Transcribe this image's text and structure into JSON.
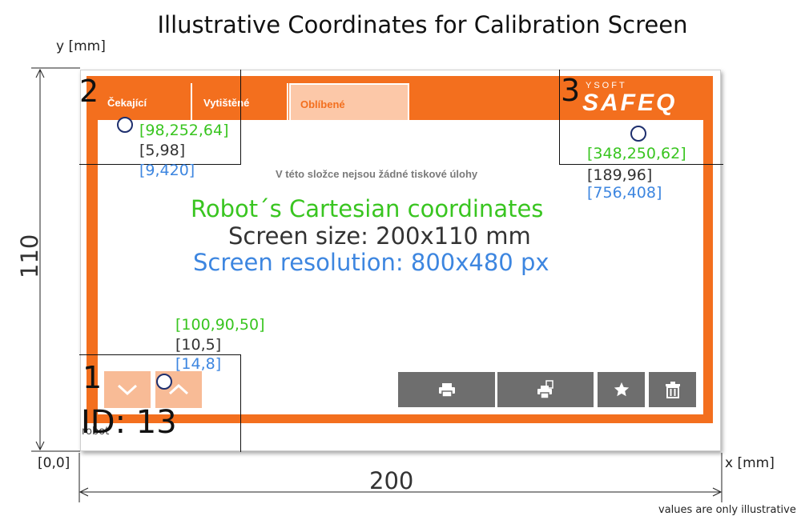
{
  "title": "Illustrative Coordinates for Calibration Screen",
  "axes": {
    "y_label": "y [mm]",
    "x_label": "x [mm]",
    "origin": "[0,0]",
    "height_dim": "110",
    "width_dim": "200"
  },
  "note": "values are only illustrative",
  "screen": {
    "tabs": [
      {
        "label": "Čekající",
        "active": false
      },
      {
        "label": "Vytištěné",
        "active": false
      },
      {
        "label": "Oblíbené",
        "active": true
      }
    ],
    "logo_small": "YSOFT",
    "logo_big": "SAFEQ",
    "empty_message": "V této složce nejsou žádné tiskové úlohy",
    "colors": {
      "frame": "#f36f1e",
      "tab_active_bg": "#fcc8a8",
      "button_gray": "#6e6e6e",
      "arrow_button": "#f8bb96"
    },
    "bottom_buttons": [
      {
        "icon": "printer-icon"
      },
      {
        "icon": "print-copies-icon"
      },
      {
        "icon": "star-icon"
      },
      {
        "icon": "trash-icon"
      }
    ],
    "arrow_buttons": [
      {
        "icon": "chevron-down-icon"
      },
      {
        "icon": "chevron-up-icon"
      }
    ]
  },
  "headlines": {
    "robot": "Robot´s Cartesian coordinates",
    "size": "Screen size: 200x110 mm",
    "resolution": "Screen resolution: 800x480 px"
  },
  "legend_colors": {
    "robot": "#39c520",
    "size": "#333333",
    "resolution": "#3d86e0"
  },
  "points": [
    {
      "number": "1",
      "robot": "[100,90,50]",
      "mm": "[10,5]",
      "px": "[14,8]"
    },
    {
      "number": "2",
      "robot": "[98,252,64]",
      "mm": "[5,98]",
      "px": "[9,420]"
    },
    {
      "number": "3",
      "robot": "[348,250,62]",
      "mm": "[189,96]",
      "px": "[756,408]"
    }
  ],
  "marker": {
    "id_text": "ID: 13",
    "robot_text": "robot"
  }
}
